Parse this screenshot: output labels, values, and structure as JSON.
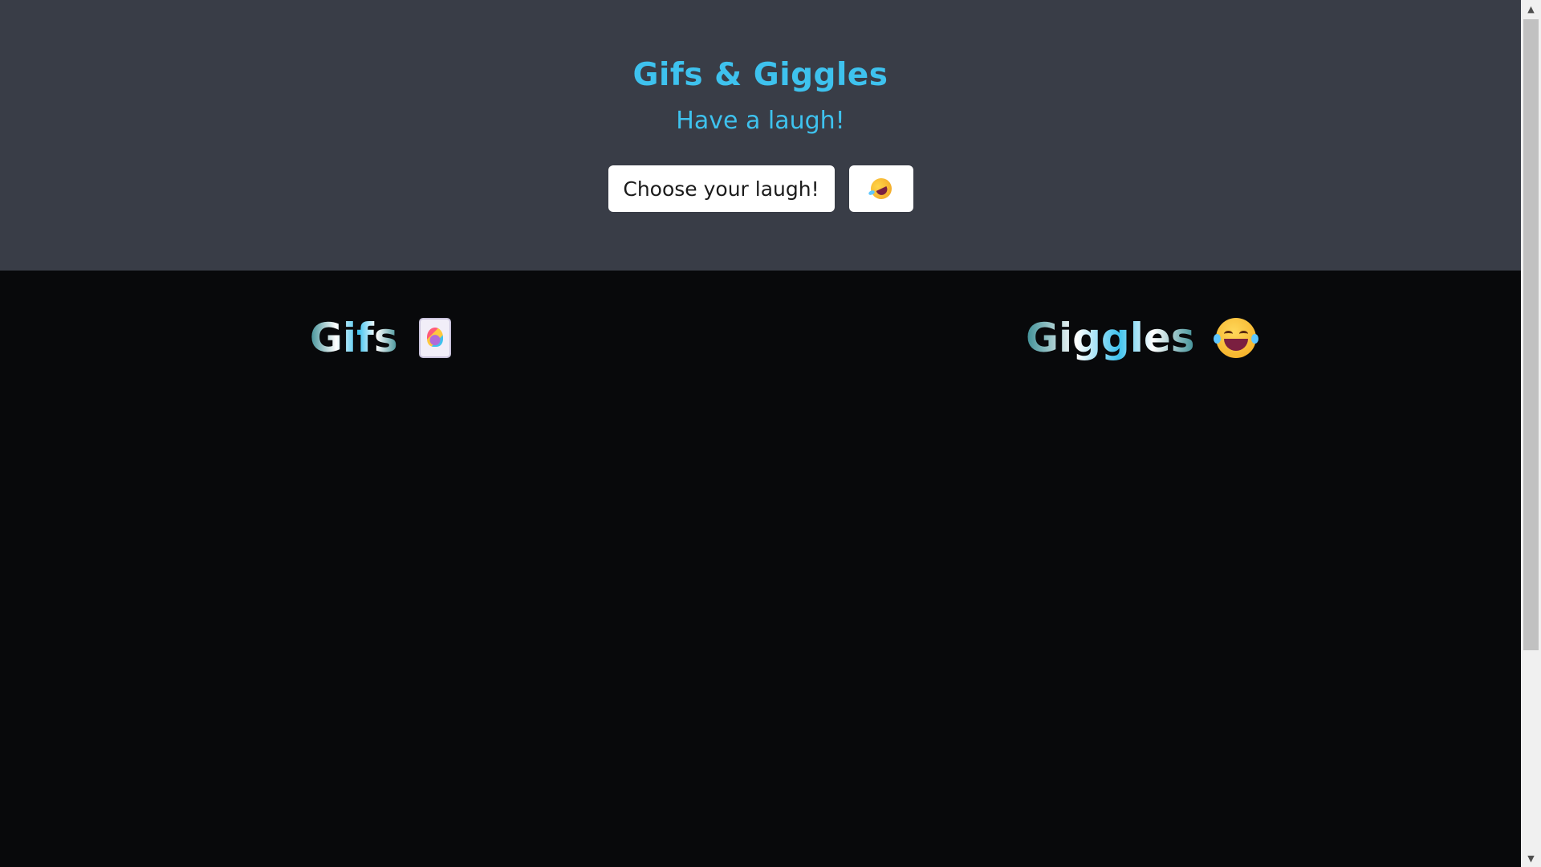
{
  "header": {
    "title": "Gifs & Giggles",
    "subtitle": "Have a laugh!",
    "choose_button_label": "Choose your laugh!",
    "emoji_button_icon": "rolling-on-floor-laughing-icon"
  },
  "sections": {
    "gifs": {
      "title": "Gifs",
      "icon": "joker-card-icon"
    },
    "giggles": {
      "title": "Giggles",
      "icon": "face-with-tears-of-joy-icon"
    }
  },
  "colors": {
    "header_bg": "#393d47",
    "accent": "#3ec2ee",
    "page_bg": "#08090b"
  }
}
